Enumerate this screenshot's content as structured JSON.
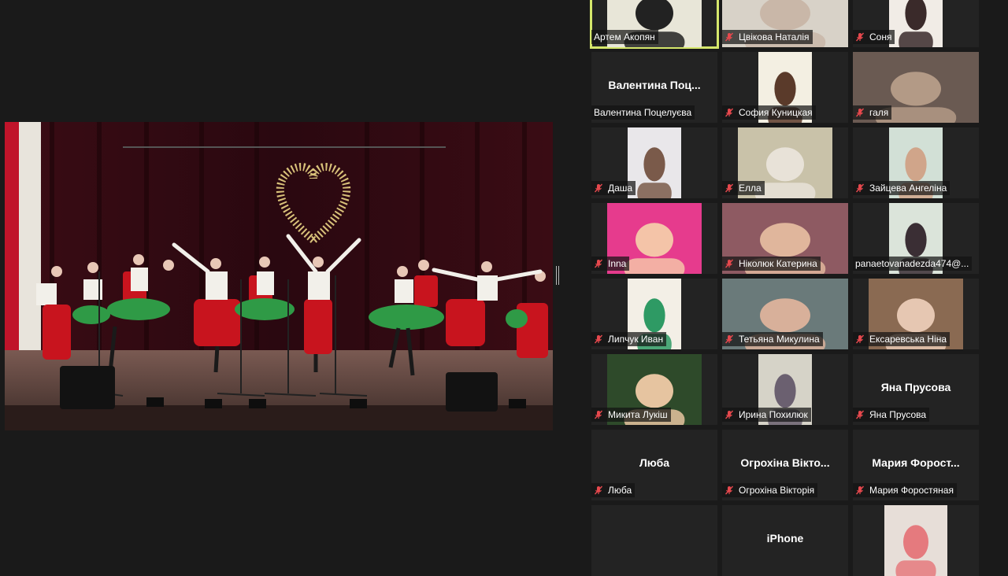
{
  "colors": {
    "background": "#1a1a1a",
    "tile": "#232323",
    "active_border": "#d5e76b",
    "mic_muted": "#e5484d"
  },
  "share": {
    "label": ""
  },
  "participants": [
    {
      "name": "Артем Акопян",
      "muted": false,
      "active": true,
      "video": true
    },
    {
      "name": "Цвікова Наталія",
      "muted": true,
      "video": true
    },
    {
      "name": "Соня",
      "muted": true,
      "video": true
    },
    {
      "name": "Валентина Поцелуєва",
      "display": "Валентина  Поц...",
      "muted": false,
      "video": false
    },
    {
      "name": "София Куницкая",
      "muted": true,
      "video": true
    },
    {
      "name": "галя",
      "muted": true,
      "video": true
    },
    {
      "name": "Даша",
      "muted": true,
      "video": true
    },
    {
      "name": "Елла",
      "muted": true,
      "video": true
    },
    {
      "name": "Зайцева Ангеліна",
      "muted": true,
      "video": true
    },
    {
      "name": "Inna",
      "muted": true,
      "video": true
    },
    {
      "name": "Ніколюк Катерина",
      "muted": true,
      "video": true
    },
    {
      "name": "panaetovanadezda474@...",
      "muted": false,
      "video": true
    },
    {
      "name": "Липчук Иван",
      "muted": true,
      "video": true
    },
    {
      "name": "Тетьяна Микулина",
      "muted": true,
      "video": true
    },
    {
      "name": "Ексаревська Ніна",
      "muted": true,
      "video": true
    },
    {
      "name": "Микита Лукіш",
      "muted": true,
      "video": true
    },
    {
      "name": "Ирина Похилюк",
      "muted": true,
      "video": true
    },
    {
      "name": "Яна Прусова",
      "display": "Яна Прусова",
      "muted": true,
      "video": false
    },
    {
      "name": "Люба",
      "display": "Люба",
      "muted": true,
      "video": false
    },
    {
      "name": "Огрохіна Вікторія",
      "display": "Огрохіна Вікто...",
      "muted": true,
      "video": false
    },
    {
      "name": "Мария Форостяная",
      "display": "Мария  Форост...",
      "muted": true,
      "video": false
    },
    {
      "name": "",
      "muted": false,
      "video": false
    },
    {
      "name": "",
      "display": "iPhone",
      "muted": false,
      "video": false
    },
    {
      "name": "",
      "muted": false,
      "video": true
    }
  ]
}
